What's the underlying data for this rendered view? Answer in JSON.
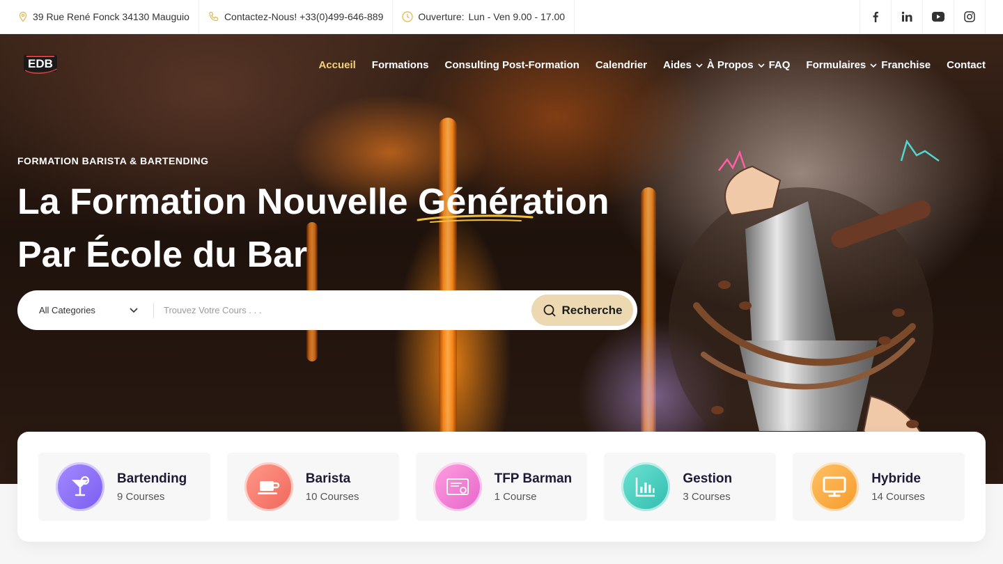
{
  "topbar": {
    "address": "39 Rue René Fonck 34130 Mauguio",
    "contact": "Contactez-Nous! +33(0)499-646-889",
    "hours_label": "Ouverture:",
    "hours_value": "Lun - Ven 9.00 - 17.00",
    "icon_color": "#e0b64a",
    "socials": [
      "facebook-icon",
      "linkedin-icon",
      "youtube-icon",
      "instagram-icon"
    ]
  },
  "logo": {
    "text": "EDB"
  },
  "nav": {
    "items": [
      {
        "label": "Accueil",
        "active": true
      },
      {
        "label": "Formations"
      },
      {
        "label": "Consulting Post-Formation"
      },
      {
        "label": "Calendrier"
      },
      {
        "label": "Aides",
        "dropdown": true
      },
      {
        "label": "À Propos",
        "dropdown": true
      },
      {
        "label": "FAQ"
      },
      {
        "label": "Formulaires",
        "dropdown": true
      },
      {
        "label": "Franchise"
      },
      {
        "label": "Contact"
      }
    ],
    "active_color": "#f3d27a"
  },
  "hero": {
    "eyebrow": "FORMATION BARISTA & BARTENDING",
    "headline_line1": "La Formation Nouvelle Génération",
    "headline_line2": "Par École du Bar"
  },
  "search": {
    "category": "All Categories",
    "placeholder": "Trouvez Votre Cours . . .",
    "button_label": "Recherche",
    "button_color": "#ecd9b2"
  },
  "categories": [
    {
      "name": "Bartending",
      "count": "9 Courses",
      "icon": "cocktail-icon",
      "color_from": "#a48bff",
      "color_to": "#7a5cf0"
    },
    {
      "name": "Barista",
      "count": "10 Courses",
      "icon": "coffee-cup-icon",
      "color_from": "#ff9a8a",
      "color_to": "#f0665a"
    },
    {
      "name": "TFP Barman",
      "count": "1 Course",
      "icon": "certificate-icon",
      "color_from": "#ff9ee0",
      "color_to": "#e566c9"
    },
    {
      "name": "Gestion",
      "count": "3 Courses",
      "icon": "chart-icon",
      "color_from": "#6fe3d2",
      "color_to": "#2fbcae"
    },
    {
      "name": "Hybride",
      "count": "14 Courses",
      "icon": "monitor-icon",
      "color_from": "#ffc266",
      "color_to": "#f59a2a"
    }
  ]
}
